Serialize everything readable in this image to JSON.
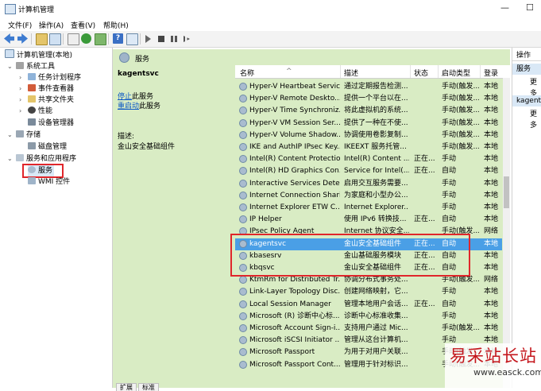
{
  "window": {
    "title": "计算机管理",
    "min": "—",
    "max": "☐"
  },
  "menu": [
    "文件(F)",
    "操作(A)",
    "查看(V)",
    "帮助(H)"
  ],
  "tree": {
    "root": "计算机管理(本地)",
    "system_tools": "系统工具",
    "task_scheduler": "任务计划程序",
    "event_viewer": "事件查看器",
    "shared_folders": "共享文件夹",
    "performance": "性能",
    "device_manager": "设备管理器",
    "storage": "存储",
    "disk_management": "磁盘管理",
    "services_apps": "服务和应用程序",
    "services": "服务",
    "wmi": "WMI 控件"
  },
  "center": {
    "header": "服务",
    "detail": {
      "name": "kagentsvc",
      "stop_link": "停止",
      "stop_rest": "此服务",
      "restart_link": "重启动",
      "restart_rest": "此服务",
      "desc_label": "描述:",
      "desc_value": "金山安全基础组件"
    },
    "tabs": [
      "扩展",
      "标准"
    ]
  },
  "columns": {
    "name": "名称",
    "desc": "描述",
    "status": "状态",
    "startup": "启动类型",
    "logon": "登录"
  },
  "rows": [
    {
      "name": "Hyper-V Heartbeat Service",
      "desc": "通过定期报告检测...",
      "status": "",
      "startup": "手动(触发...",
      "logon": "本地"
    },
    {
      "name": "Hyper-V Remote Deskto...",
      "desc": "提供一个平台以在...",
      "status": "",
      "startup": "手动(触发...",
      "logon": "本地"
    },
    {
      "name": "Hyper-V Time Synchroniz...",
      "desc": "将此虚拟机的系统...",
      "status": "",
      "startup": "手动(触发...",
      "logon": "本地"
    },
    {
      "name": "Hyper-V VM Session Ser...",
      "desc": "提供了一种在不使...",
      "status": "",
      "startup": "手动(触发...",
      "logon": "本地"
    },
    {
      "name": "Hyper-V Volume Shadow...",
      "desc": "协调使用卷影复制...",
      "status": "",
      "startup": "手动(触发...",
      "logon": "本地"
    },
    {
      "name": "IKE and AuthIP IPsec Key...",
      "desc": "IKEEXT 服务托管...",
      "status": "",
      "startup": "手动(触发...",
      "logon": "本地"
    },
    {
      "name": "Intel(R) Content Protectio...",
      "desc": "Intel(R) Content ...",
      "status": "正在...",
      "startup": "手动",
      "logon": "本地"
    },
    {
      "name": "Intel(R) HD Graphics Con...",
      "desc": "Service for Intel(...",
      "status": "正在...",
      "startup": "自动",
      "logon": "本地"
    },
    {
      "name": "Interactive Services Dete...",
      "desc": "启用交互服务需要...",
      "status": "",
      "startup": "手动",
      "logon": "本地"
    },
    {
      "name": "Internet Connection Shari...",
      "desc": "为家庭和小型办公...",
      "status": "",
      "startup": "手动",
      "logon": "本地"
    },
    {
      "name": "Internet Explorer ETW C...",
      "desc": "Internet Explorer...",
      "status": "",
      "startup": "手动",
      "logon": "本地"
    },
    {
      "name": "IP Helper",
      "desc": "使用 IPv6 转换技...",
      "status": "正在...",
      "startup": "自动",
      "logon": "本地"
    },
    {
      "name": "IPsec Policy Agent",
      "desc": "Internet 协议安全...",
      "status": "",
      "startup": "手动(触发...",
      "logon": "网络"
    },
    {
      "name": "kagentsvc",
      "desc": "金山安全基础组件",
      "status": "正在...",
      "startup": "自动",
      "logon": "本地"
    },
    {
      "name": "kbasesrv",
      "desc": "金山基础服务模块",
      "status": "正在...",
      "startup": "自动",
      "logon": "本地"
    },
    {
      "name": "kbqsvc",
      "desc": "金山安全基础组件",
      "status": "正在...",
      "startup": "自动",
      "logon": "本地"
    },
    {
      "name": "KtmRm for Distributed Tr...",
      "desc": "协调分布式事务处...",
      "status": "",
      "startup": "手动(触发...",
      "logon": "网络"
    },
    {
      "name": "Link-Layer Topology Disc...",
      "desc": "创建网络映射，它...",
      "status": "",
      "startup": "手动",
      "logon": "本地"
    },
    {
      "name": "Local Session Manager",
      "desc": "管理本地用户会话...",
      "status": "正在...",
      "startup": "自动",
      "logon": "本地"
    },
    {
      "name": "Microsoft (R) 诊断中心标...",
      "desc": "诊断中心标准收集...",
      "status": "",
      "startup": "手动",
      "logon": "本地"
    },
    {
      "name": "Microsoft Account Sign-i...",
      "desc": "支持用户通过 Mic...",
      "status": "",
      "startup": "手动(触发...",
      "logon": "本地"
    },
    {
      "name": "Microsoft iSCSI Initiator ...",
      "desc": "管理从这台计算机...",
      "status": "",
      "startup": "手动",
      "logon": "本地"
    },
    {
      "name": "Microsoft Passport",
      "desc": "为用于对用户关联...",
      "status": "",
      "startup": "手动(触发...",
      "logon": "本地"
    },
    {
      "name": "Microsoft Passport Cont...",
      "desc": "管理用于针对标识...",
      "status": "",
      "startup": "手动(触发...",
      "logon": "本地"
    }
  ],
  "selected_index": 13,
  "actions": {
    "header": "操作",
    "sec1": "服务",
    "more1": "更多",
    "sec2": "kagentsvc",
    "more2": "更多"
  },
  "watermark": {
    "big": "易采站长站",
    "small": "www.easck.com"
  },
  "colors": {
    "accent_green": "#d9ecc4",
    "selection": "#4a9fe6",
    "highlight": "#e0262b"
  }
}
